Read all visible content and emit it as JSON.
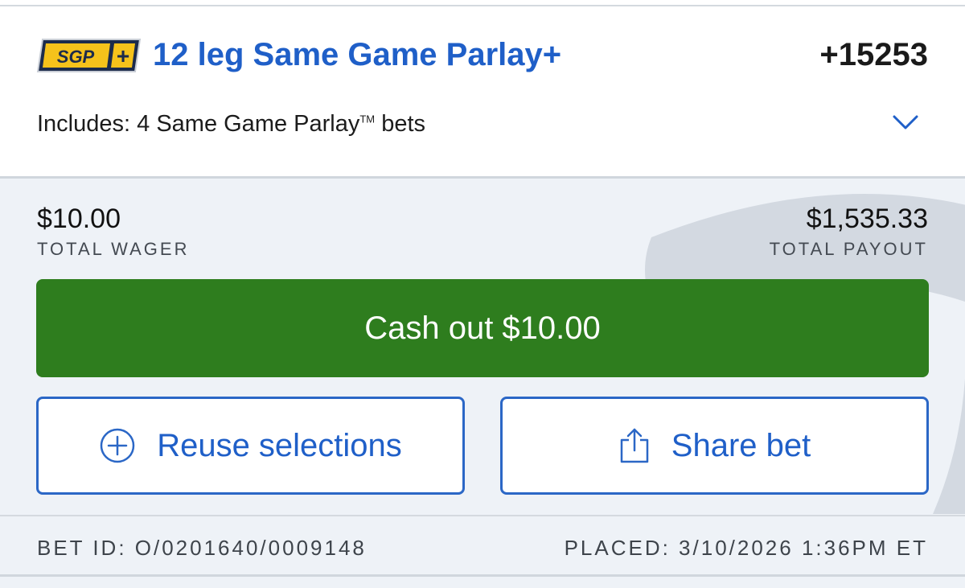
{
  "bet": {
    "badge": {
      "text": "SGP",
      "plus": "+"
    },
    "title": "12 leg Same Game Parlay+",
    "odds": "+15253",
    "includes_prefix": "Includes: 4 Same Game Parlay",
    "includes_tm": "TM",
    "includes_suffix": " bets",
    "expand_icon": "chevron-down-icon"
  },
  "summary": {
    "wager_amount": "$10.00",
    "wager_label": "TOTAL WAGER",
    "payout_amount": "$1,535.33",
    "payout_label": "TOTAL PAYOUT"
  },
  "actions": {
    "cashout_label": "Cash out $10.00",
    "reuse_label": "Reuse selections",
    "reuse_icon": "plus-circle-icon",
    "share_label": "Share bet",
    "share_icon": "share-icon"
  },
  "footer": {
    "bet_id": "BET ID: O/0201640/0009148",
    "placed": "PLACED: 3/10/2026 1:36PM ET"
  },
  "colors": {
    "brand_blue": "#1f5fc8",
    "cashout_green": "#2e7d1e",
    "badge_navy": "#1c2b4b",
    "badge_yellow": "#f5c21b",
    "background": "#eef2f7"
  }
}
